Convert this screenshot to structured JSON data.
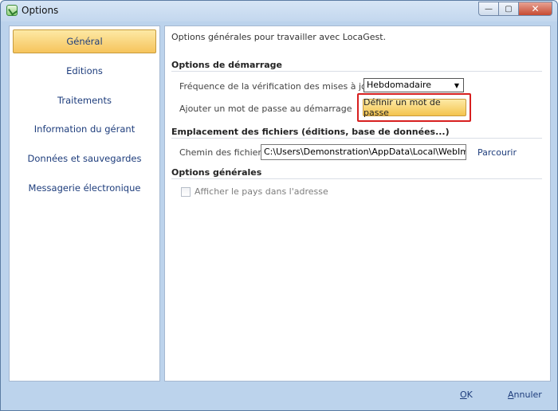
{
  "window": {
    "title": "Options",
    "controls": {
      "minimize": "—",
      "maximize": "▢",
      "close": "✕"
    }
  },
  "sidebar": {
    "items": [
      {
        "label": "Général",
        "active": true
      },
      {
        "label": "Editions",
        "active": false
      },
      {
        "label": "Traitements",
        "active": false
      },
      {
        "label": "Information du gérant",
        "active": false
      },
      {
        "label": "Données et sauvegardes",
        "active": false
      },
      {
        "label": "Messagerie électronique",
        "active": false
      }
    ]
  },
  "main": {
    "intro": "Options générales pour travailler avec LocaGest.",
    "startup": {
      "title": "Options de démarrage",
      "update_label": "Fréquence de la vérification des mises à jour",
      "update_value": "Hebdomadaire",
      "password_label": "Ajouter un mot de passe au démarrage",
      "password_button": "Définir un mot de passe"
    },
    "files": {
      "title": "Emplacement des fichiers (éditions, base de données...)",
      "path_label": "Chemin des fichiers",
      "path_value": "C:\\Users\\Demonstration\\AppData\\Local\\WebImmo\\LocaGest",
      "browse_label": "Parcourir"
    },
    "general": {
      "title": "Options générales",
      "country_checkbox_label": "Afficher le pays dans l'adresse",
      "country_checked": false
    }
  },
  "footer": {
    "ok_label": "OK",
    "cancel_label": "Annuler"
  },
  "colors": {
    "window_bg": "#bcd3ec",
    "nav_text": "#1e3d7c",
    "active_gradient_top": "#fde9a5",
    "active_gradient_bottom": "#f6c45c",
    "highlight_border": "#d72020"
  }
}
